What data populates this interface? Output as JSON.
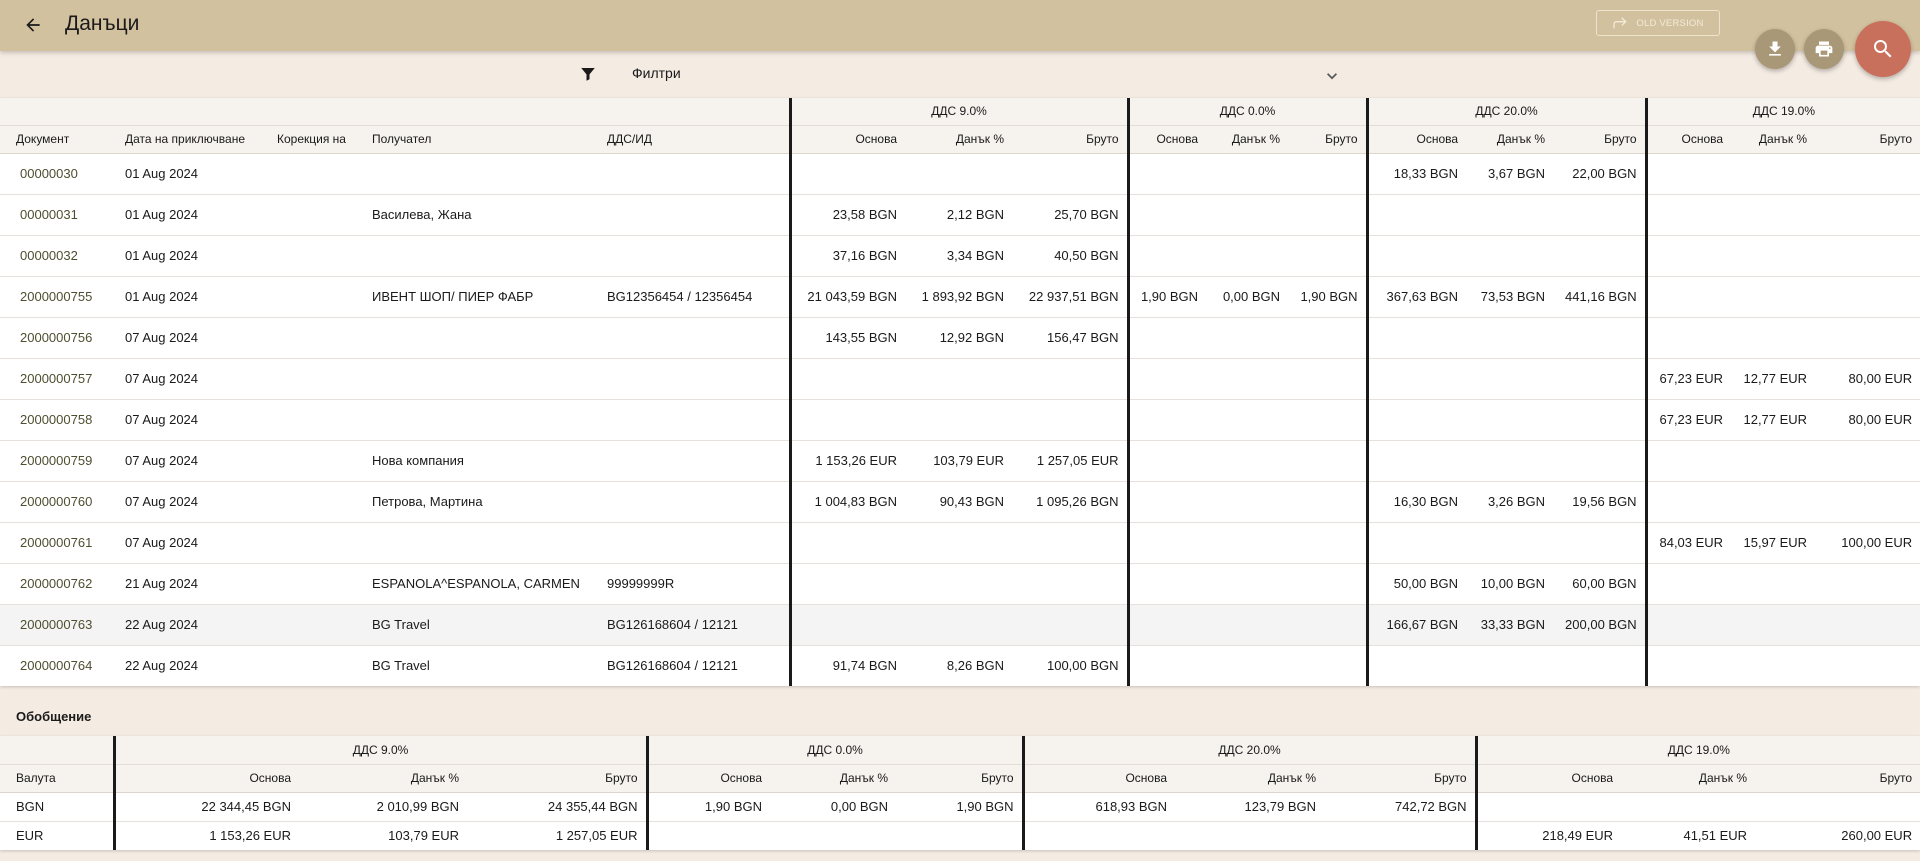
{
  "header": {
    "title": "Данъци",
    "old_version_label": "OLD VERSION"
  },
  "filter": {
    "label": "Филтри"
  },
  "colors": {
    "topbar": "#d2c19e",
    "search_fab": "#c9705c",
    "action_fab": "#a99878",
    "background": "#f4ebe2"
  },
  "icons": [
    "back-arrow-icon",
    "redo-arrow-icon",
    "download-icon",
    "print-icon",
    "search-icon",
    "filter-icon",
    "chevron-down-icon"
  ],
  "table": {
    "groups": [
      "ДДС 9.0%",
      "ДДС 0.0%",
      "ДДС 20.0%",
      "ДДС 19.0%"
    ],
    "columns": {
      "document": "Документ",
      "close_date": "Дата на приключване",
      "correction": "Корекция на",
      "recipient": "Получател",
      "vat_id": "ДДС/ИД",
      "base": "Основа",
      "tax": "Данък %",
      "gross": "Бруто"
    },
    "rows": [
      {
        "doc": "00000030",
        "date": "01 Aug 2024",
        "corr": "",
        "recipient": "",
        "vat": "",
        "v9": [
          "",
          "",
          ""
        ],
        "v0": [
          "",
          "",
          ""
        ],
        "v20": [
          "18,33 BGN",
          "3,67 BGN",
          "22,00 BGN"
        ],
        "v19": [
          "",
          "",
          ""
        ]
      },
      {
        "doc": "00000031",
        "date": "01 Aug 2024",
        "corr": "",
        "recipient": "Василева, Жана",
        "vat": "",
        "v9": [
          "23,58 BGN",
          "2,12 BGN",
          "25,70 BGN"
        ],
        "v0": [
          "",
          "",
          ""
        ],
        "v20": [
          "",
          "",
          ""
        ],
        "v19": [
          "",
          "",
          ""
        ]
      },
      {
        "doc": "00000032",
        "date": "01 Aug 2024",
        "corr": "",
        "recipient": "",
        "vat": "",
        "v9": [
          "37,16 BGN",
          "3,34 BGN",
          "40,50 BGN"
        ],
        "v0": [
          "",
          "",
          ""
        ],
        "v20": [
          "",
          "",
          ""
        ],
        "v19": [
          "",
          "",
          ""
        ]
      },
      {
        "doc": "2000000755",
        "date": "01 Aug 2024",
        "corr": "",
        "recipient": "ИВЕНТ ШОП/ ПИЕР ФАБР",
        "vat": "BG12356454 / 12356454",
        "v9": [
          "21 043,59 BGN",
          "1 893,92 BGN",
          "22 937,51 BGN"
        ],
        "v0": [
          "1,90 BGN",
          "0,00 BGN",
          "1,90 BGN"
        ],
        "v20": [
          "367,63 BGN",
          "73,53 BGN",
          "441,16 BGN"
        ],
        "v19": [
          "",
          "",
          ""
        ]
      },
      {
        "doc": "2000000756",
        "date": "07 Aug 2024",
        "corr": "",
        "recipient": "",
        "vat": "",
        "v9": [
          "143,55 BGN",
          "12,92 BGN",
          "156,47 BGN"
        ],
        "v0": [
          "",
          "",
          ""
        ],
        "v20": [
          "",
          "",
          ""
        ],
        "v19": [
          "",
          "",
          ""
        ]
      },
      {
        "doc": "2000000757",
        "date": "07 Aug 2024",
        "corr": "",
        "recipient": "",
        "vat": "",
        "v9": [
          "",
          "",
          ""
        ],
        "v0": [
          "",
          "",
          ""
        ],
        "v20": [
          "",
          "",
          ""
        ],
        "v19": [
          "67,23 EUR",
          "12,77 EUR",
          "80,00 EUR"
        ]
      },
      {
        "doc": "2000000758",
        "date": "07 Aug 2024",
        "corr": "",
        "recipient": "",
        "vat": "",
        "v9": [
          "",
          "",
          ""
        ],
        "v0": [
          "",
          "",
          ""
        ],
        "v20": [
          "",
          "",
          ""
        ],
        "v19": [
          "67,23 EUR",
          "12,77 EUR",
          "80,00 EUR"
        ]
      },
      {
        "doc": "2000000759",
        "date": "07 Aug 2024",
        "corr": "",
        "recipient": "Нова компания",
        "vat": "",
        "v9": [
          "1 153,26 EUR",
          "103,79 EUR",
          "1 257,05 EUR"
        ],
        "v0": [
          "",
          "",
          ""
        ],
        "v20": [
          "",
          "",
          ""
        ],
        "v19": [
          "",
          "",
          ""
        ]
      },
      {
        "doc": "2000000760",
        "date": "07 Aug 2024",
        "corr": "",
        "recipient": "Петрова, Мартина",
        "vat": "",
        "v9": [
          "1 004,83 BGN",
          "90,43 BGN",
          "1 095,26 BGN"
        ],
        "v0": [
          "",
          "",
          ""
        ],
        "v20": [
          "16,30 BGN",
          "3,26 BGN",
          "19,56 BGN"
        ],
        "v19": [
          "",
          "",
          ""
        ]
      },
      {
        "doc": "2000000761",
        "date": "07 Aug 2024",
        "corr": "",
        "recipient": "",
        "vat": "",
        "v9": [
          "",
          "",
          ""
        ],
        "v0": [
          "",
          "",
          ""
        ],
        "v20": [
          "",
          "",
          ""
        ],
        "v19": [
          "84,03 EUR",
          "15,97 EUR",
          "100,00 EUR"
        ]
      },
      {
        "doc": "2000000762",
        "date": "21 Aug 2024",
        "corr": "",
        "recipient": "ESPANOLA^ESPANOLA, CARMEN",
        "vat": "99999999R",
        "v9": [
          "",
          "",
          ""
        ],
        "v0": [
          "",
          "",
          ""
        ],
        "v20": [
          "50,00 BGN",
          "10,00 BGN",
          "60,00 BGN"
        ],
        "v19": [
          "",
          "",
          ""
        ]
      },
      {
        "doc": "2000000763",
        "date": "22 Aug 2024",
        "corr": "",
        "recipient": "BG Travel",
        "vat": "BG126168604 / 12121",
        "v9": [
          "",
          "",
          ""
        ],
        "v0": [
          "",
          "",
          ""
        ],
        "v20": [
          "166,67 BGN",
          "33,33 BGN",
          "200,00 BGN"
        ],
        "v19": [
          "",
          "",
          ""
        ]
      },
      {
        "doc": "2000000764",
        "date": "22 Aug 2024",
        "corr": "",
        "recipient": "BG Travel",
        "vat": "BG126168604 / 12121",
        "v9": [
          "91,74 BGN",
          "8,26 BGN",
          "100,00 BGN"
        ],
        "v0": [
          "",
          "",
          ""
        ],
        "v20": [
          "",
          "",
          ""
        ],
        "v19": [
          "",
          "",
          ""
        ]
      }
    ]
  },
  "summary": {
    "title": "Обобщение",
    "currency_label": "Валута",
    "rows": [
      {
        "cur": "BGN",
        "v9": [
          "22 344,45 BGN",
          "2 010,99 BGN",
          "24 355,44 BGN"
        ],
        "v0": [
          "1,90 BGN",
          "0,00 BGN",
          "1,90 BGN"
        ],
        "v20": [
          "618,93 BGN",
          "123,79 BGN",
          "742,72 BGN"
        ],
        "v19": [
          "",
          "",
          ""
        ]
      },
      {
        "cur": "EUR",
        "v9": [
          "1 153,26 EUR",
          "103,79 EUR",
          "1 257,05 EUR"
        ],
        "v0": [
          "",
          "",
          ""
        ],
        "v20": [
          "",
          "",
          ""
        ],
        "v19": [
          "218,49 EUR",
          "41,51 EUR",
          "260,00 EUR"
        ]
      }
    ]
  }
}
